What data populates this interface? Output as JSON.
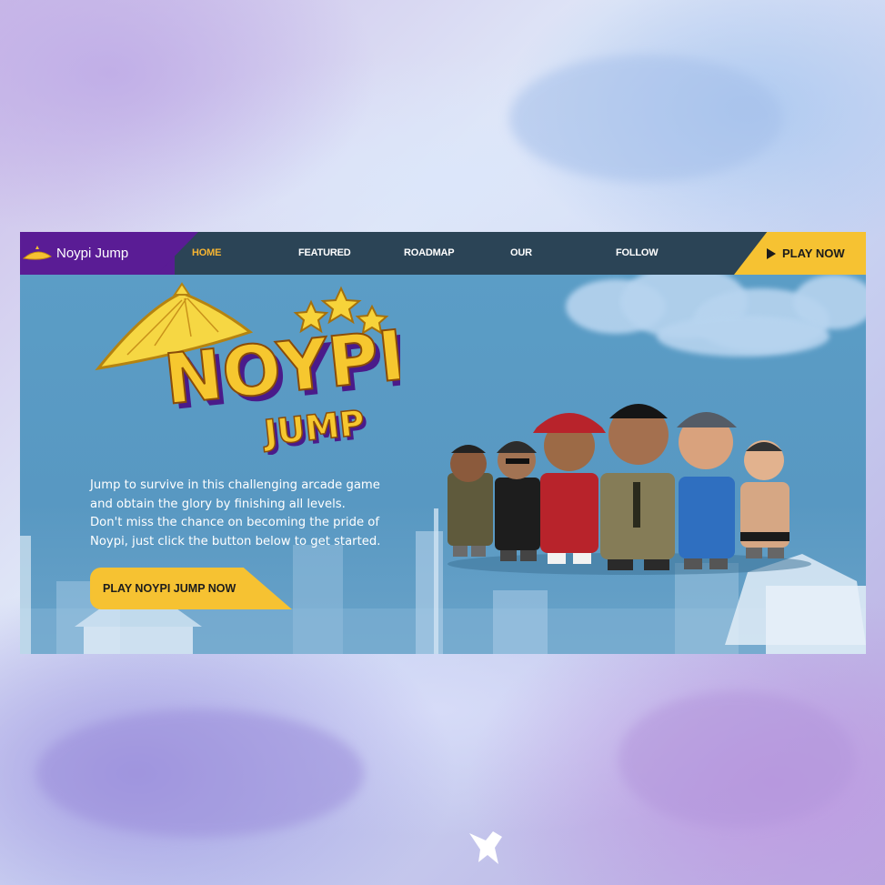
{
  "brand": {
    "name": "Noypi Jump"
  },
  "nav": {
    "items": [
      {
        "label": "HOME",
        "active": true
      },
      {
        "label": "FEATURED",
        "active": false
      },
      {
        "label": "ROADMAP",
        "active": false
      },
      {
        "label": "OUR TEAM",
        "active": false
      },
      {
        "label": "FOLLOW US",
        "active": false
      }
    ],
    "play_button": {
      "label": "PLAY NOW",
      "icon": "play-icon"
    }
  },
  "hero": {
    "logo": {
      "line1": "NOYPI",
      "line2": "JUMP"
    },
    "description": [
      "Jump to survive in this challenging arcade game",
      "and obtain the glory by finishing all levels.",
      "Don't miss the chance on becoming the pride of",
      "Noypi, just click the button below to get started."
    ],
    "cta_label": "PLAY NOYPI JUMP NOW"
  },
  "colors": {
    "brand_purple": "#5a1c95",
    "nav_bg": "#2b4456",
    "accent_yellow": "#f6c232",
    "active_link": "#f6b532",
    "hero_blue": "#5a9bc4"
  }
}
